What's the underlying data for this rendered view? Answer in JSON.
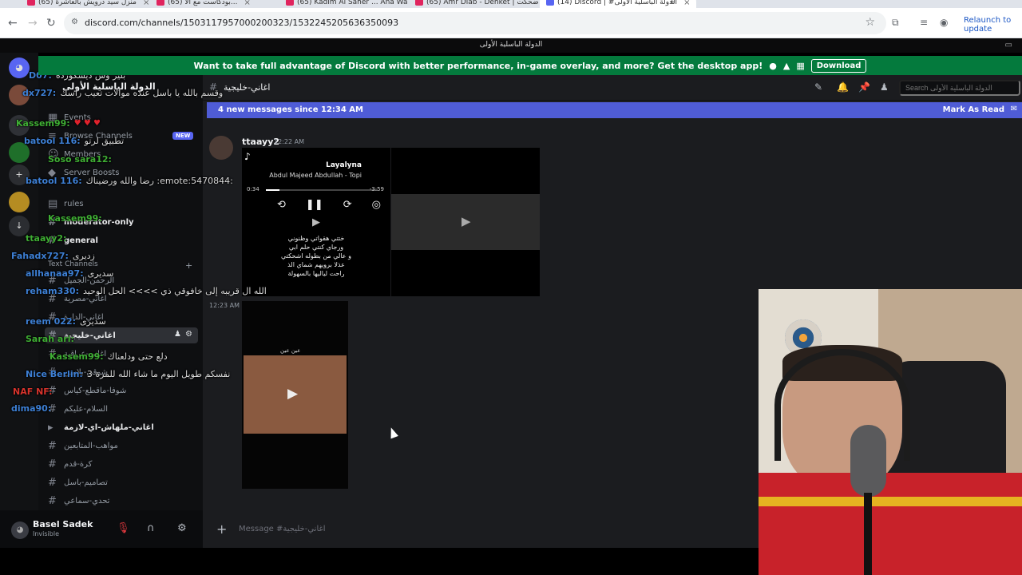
{
  "browser": {
    "tabs": [
      {
        "label": "(65) منزل سيد درويش بالعاشرة"
      },
      {
        "label": "(65) بودكاست مع الأ..."
      },
      {
        "label": "(65) Kadim Al Saher ... Ana Wa"
      },
      {
        "label": "(65) Amr Diab - Dehket | ضحكت"
      },
      {
        "label": "(14) Discord | #الدولة الباسلية الأولى"
      }
    ],
    "url": "discord.com/channels/1503117957000200323/1532245205636350093",
    "relaunch_label": "Relaunch to update"
  },
  "discord": {
    "window_title": "الدولة الباسلية الأولى",
    "promo_text": "Want to take full advantage of Discord with better performance, in-game overlay, and more? Get the desktop app!",
    "promo_button": "Download",
    "server_name": "الدولة الباسلية الأولى",
    "sidebar": {
      "items": [
        {
          "label": "Events"
        },
        {
          "label": "Browse Channels"
        },
        {
          "label": "Members"
        },
        {
          "label": "Server Boosts"
        },
        {
          "label": "rules"
        },
        {
          "label": "moderator-only"
        },
        {
          "label": "general"
        }
      ],
      "new_badge": "NEW",
      "category_text": "Text Channels",
      "channels": [
        {
          "label": "الرحمن-الجميل"
        },
        {
          "label": "اغاني-مصرية"
        },
        {
          "label": "اغاني-الدارة"
        },
        {
          "label": "اغاني-خليجية"
        },
        {
          "label": "اغاني-عراقية"
        },
        {
          "label": "شوقي-بلاسن"
        },
        {
          "label": "شوفا-ماقطع-كياس"
        },
        {
          "label": "السلام-عليكم"
        },
        {
          "label": "اغاني-ملهاش-اي-لازمة"
        },
        {
          "label": "مواهب-المتابعين"
        },
        {
          "label": "كرة-قدم"
        },
        {
          "label": "تصاميم-باسل"
        },
        {
          "label": "تحدي-سماعي"
        }
      ]
    },
    "user": {
      "name": "Basel Sadek",
      "status": "Invisible"
    },
    "channel_name": "اغاني-خليجية",
    "search_placeholder": "Search الدولة الباسلية الأولى",
    "new_messages_text": "4 new messages since 12:34 AM",
    "mark_read": "Mark As Read",
    "message": {
      "author": "ttaayy2",
      "timestamp": "12:22 AM",
      "second_timestamp": "12:23 AM",
      "song_title": "Layalyna",
      "song_artist": "Abdul Majeed Abdullah - Topi",
      "time_elapsed": "0:34",
      "time_remaining": "-3:59",
      "lyrics": "ختتي هقواتي وظنوني\nورجاي كنتي حلم ابي\nو عالي من بطوله اشحكتي\nعذلا برويهم شماي الذ\nراحت لياليها بالسهولة",
      "video_caption": "عين عين"
    },
    "composer_placeholder": "Message #اغاني-خليجية"
  },
  "overlay_chat": [
    {
      "user": "D07:",
      "text": "بليز وش ديسكوردة",
      "color": "blue"
    },
    {
      "user": "dx727:",
      "text": "وقسم بالله يا باسل عنده موالات تعيب راسك",
      "color": "blue"
    },
    {
      "user": "Kassem99:",
      "text": "♥ ♥ ♥",
      "color": "green"
    },
    {
      "user": "batool 116:",
      "text": "تطبيق لرتو",
      "color": "blue"
    },
    {
      "user": "Soso sara12:",
      "text": "",
      "color": "green"
    },
    {
      "user": "batool 116:",
      "text": "رضا والله ورضيناك :emote:5470844:",
      "color": "blue"
    },
    {
      "user": "Kassem99:",
      "text": "",
      "color": "green"
    },
    {
      "user": "ttaayy2:",
      "text": "",
      "color": "green"
    },
    {
      "user": "Fahadx727:",
      "text": "زديرى",
      "color": "blue"
    },
    {
      "user": "allhanaa97:",
      "text": "سديرى",
      "color": "blue"
    },
    {
      "user": "reham330:",
      "text": "الله ال قريبه إلى خافوقي ذي >>>> الحل الوحيد",
      "color": "blue"
    },
    {
      "user": "reem 022:",
      "text": "سديرى",
      "color": "blue"
    },
    {
      "user": "Sarah ari:",
      "text": "",
      "color": "green"
    },
    {
      "user": "Kassem99:",
      "text": "دلع حتى ودلعناك",
      "color": "green"
    },
    {
      "user": "Nice Berlin:",
      "text": "نفسكم طويل اليوم ما شاء الله للمرة 3",
      "color": "blue"
    },
    {
      "user": "NAF NF:",
      "text": "",
      "color": "red"
    },
    {
      "user": "dima90:",
      "text": "",
      "color": "blue"
    }
  ]
}
